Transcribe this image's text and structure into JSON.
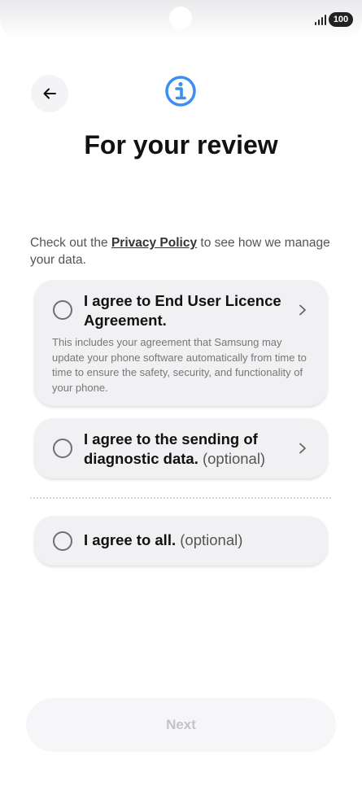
{
  "status_bar": {
    "battery": "100"
  },
  "header": {
    "title": "For your review"
  },
  "intro": {
    "prefix": "Check out the ",
    "link": "Privacy Policy",
    "suffix": " to see how we manage your data."
  },
  "agreements": [
    {
      "title": "I agree to End User Licence Agreement.",
      "description": "This includes your agreement that Samsung may update your phone software automatically from time to time to ensure the safety, security, and functionality of your phone."
    },
    {
      "title": "I agree to the sending of diagnostic data.",
      "optional": "(optional)"
    }
  ],
  "agree_all": {
    "title": "I agree to all.",
    "optional": "(optional)"
  },
  "footer": {
    "next_label": "Next"
  },
  "colors": {
    "info_icon": "#3a8ff0",
    "card_bg": "#f1f1f3",
    "disabled_text": "#c4c4c8"
  }
}
